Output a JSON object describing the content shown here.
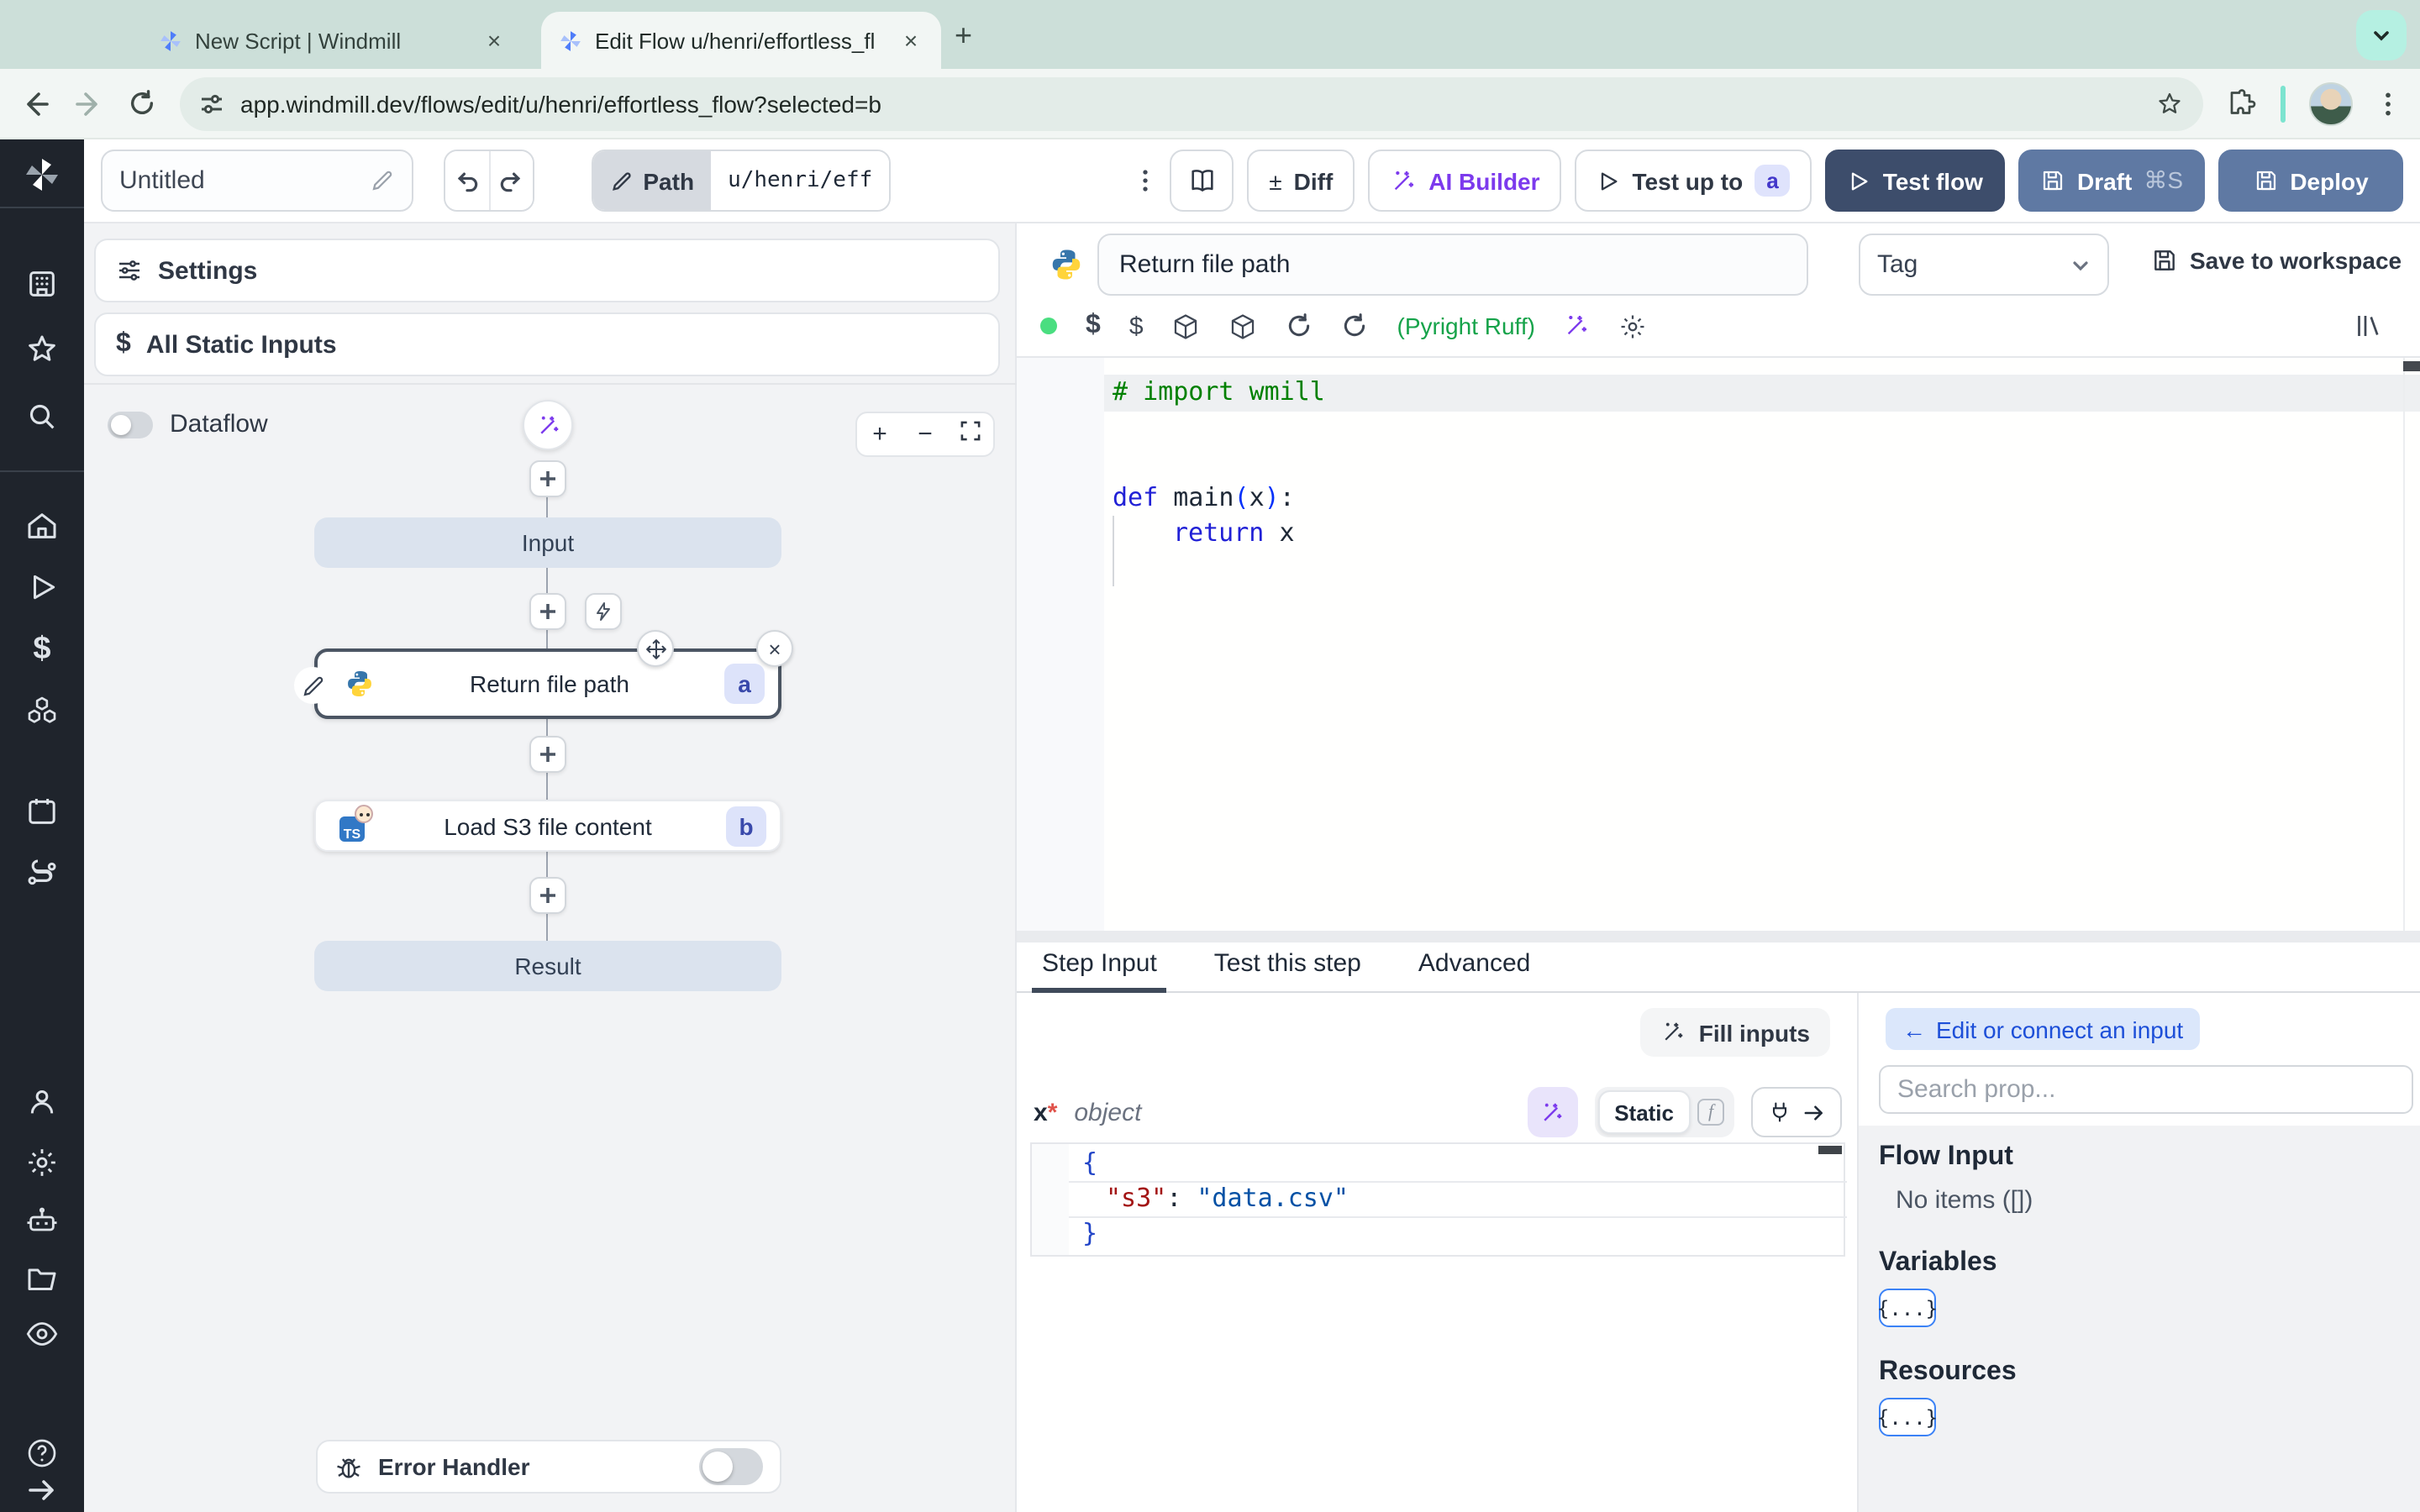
{
  "browser": {
    "tab1_title": "New Script | Windmill",
    "tab2_title": "Edit Flow u/henri/effortless_fl",
    "url": "app.windmill.dev/flows/edit/u/henri/effortless_flow?selected=b"
  },
  "toolbar": {
    "flow_name": "Untitled",
    "path_label": "Path",
    "path_value": "u/henri/eff",
    "diff_label": "Diff",
    "ai_builder_label": "AI Builder",
    "test_up_to_label": "Test up to",
    "test_up_to_badge": "a",
    "test_flow_label": "Test flow",
    "draft_label": "Draft",
    "draft_shortcut": "⌘S",
    "deploy_label": "Deploy"
  },
  "flow_panel": {
    "settings_label": "Settings",
    "all_static_inputs_label": "All Static Inputs",
    "dataflow_label": "Dataflow",
    "input_node_label": "Input",
    "step_a_label": "Return file path",
    "step_a_badge": "a",
    "step_b_label": "Load S3 file content",
    "step_b_badge": "b",
    "result_node_label": "Result",
    "error_handler_label": "Error Handler"
  },
  "step_header": {
    "name_value": "Return file path",
    "tag_label": "Tag",
    "save_label": "Save to workspace",
    "lint_label": "(Pyright Ruff)"
  },
  "code": {
    "comment": "# import wmill",
    "kw_def": "def",
    "fn_name": "main",
    "paren_open": "(",
    "param": "x",
    "paren_close": ")",
    "colon": ":",
    "kw_return": "return",
    "return_val": "x"
  },
  "bottom_tabs": {
    "step_input": "Step Input",
    "test_step": "Test this step",
    "advanced": "Advanced"
  },
  "step_input": {
    "fill_label": "Fill inputs",
    "arg_name": "x",
    "arg_star": "*",
    "arg_type": "object",
    "static_label": "Static",
    "fn_glyph": "f",
    "json_open": "{",
    "json_key": "\"s3\"",
    "json_colon": ":",
    "json_value": "\"data.csv\"",
    "json_close": "}"
  },
  "connect": {
    "back_arrow": "←",
    "edit_connect_label": "Edit or connect an input",
    "search_placeholder": "Search prop...",
    "flow_input_label": "Flow Input",
    "no_items_label": "No items ([])",
    "variables_label": "Variables",
    "resources_label": "Resources",
    "braces_label": "{...}"
  },
  "colors": {
    "tabbar_mint": "#ccdfd9",
    "sidebar_dark": "#1f242c",
    "accent_indigo": "#4338ca",
    "accent_purple": "#7c3aed",
    "test_flow_bg": "#3d4d6b",
    "deploy_bg": "#5f79a3",
    "lint_green": "#16a34a",
    "comment_green": "#008000",
    "keyword_blue": "#2121d6",
    "json_key_red": "#a31515",
    "json_value_blue": "#0451a5"
  }
}
